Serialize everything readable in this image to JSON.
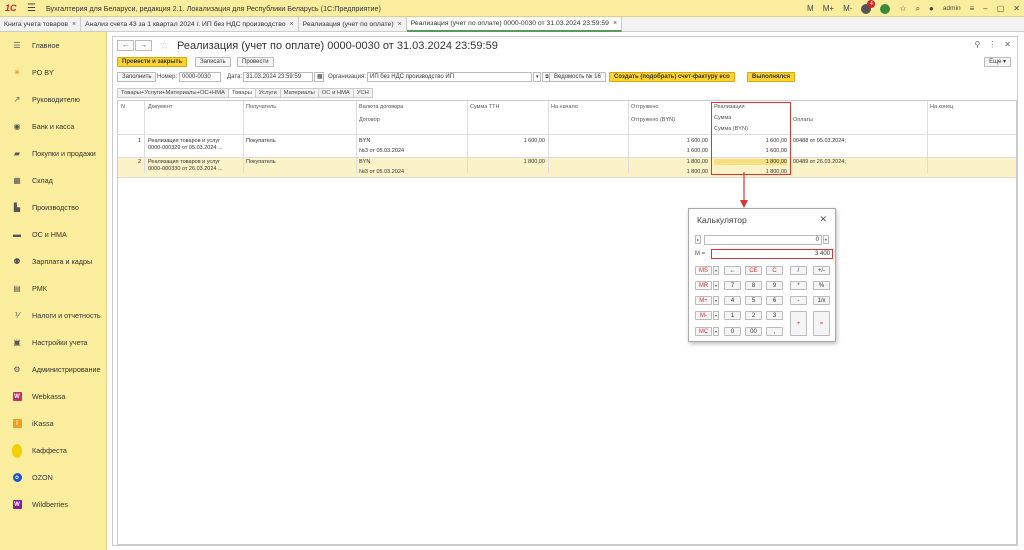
{
  "app": {
    "title": "Бухгалтерия для Беларуси, редакция 2.1. Локализация для Республики Беларусь   (1С:Предприятие)",
    "logo": "1С",
    "right_controls": [
      "M",
      "M+",
      "M-"
    ],
    "notification_count": "4",
    "user": "admin"
  },
  "tabs": [
    {
      "label": "Книга учета товаров"
    },
    {
      "label": "Анализ счета 43 за 1 квартал 2024 г. ИП без НДС производство"
    },
    {
      "label": "Реализация (учет по оплате)"
    },
    {
      "label": "Реализация (учет по оплате) 0000-0030 от 31.03.2024 23:59:59"
    }
  ],
  "sidebar": {
    "items": [
      {
        "label": "Главное",
        "icon": "menu-icon"
      },
      {
        "label": "РО BY",
        "icon": "sun-icon"
      },
      {
        "label": "Руководителю",
        "icon": "trend-icon"
      },
      {
        "label": "Банк и касса",
        "icon": "bank-icon"
      },
      {
        "label": "Покупки и продажи",
        "icon": "cart-icon"
      },
      {
        "label": "Склад",
        "icon": "warehouse-icon"
      },
      {
        "label": "Производство",
        "icon": "factory-icon"
      },
      {
        "label": "ОС и НМА",
        "icon": "car-icon"
      },
      {
        "label": "Зарплата и кадры",
        "icon": "people-icon"
      },
      {
        "label": "РМК",
        "icon": "register-icon"
      },
      {
        "label": "Налоги и отчетность",
        "icon": "tax-icon"
      },
      {
        "label": "Настройки учета",
        "icon": "settings-icon"
      },
      {
        "label": "Администрирование",
        "icon": "gear-icon"
      },
      {
        "label": "Webkassa",
        "icon": "webkassa-icon"
      },
      {
        "label": "iKassa",
        "icon": "ikassa-icon"
      },
      {
        "label": "Каффеста",
        "icon": "kaffesta-icon"
      },
      {
        "label": "OZON",
        "icon": "ozon-icon"
      },
      {
        "label": "Wildberries",
        "icon": "wildberries-icon"
      }
    ]
  },
  "document": {
    "title": "Реализация (учет по оплате) 0000-0030 от 31.03.2024 23:59:59",
    "buttons": {
      "post_close": "Провести и закрыть",
      "save": "Записать",
      "post": "Провести",
      "fill": "Заполнить",
      "invoice": "Создать (подобрать) счет-фактуру eco",
      "executed": "Выполнялся",
      "more": "Еще"
    },
    "fields": {
      "number_label": "Номер:",
      "number": "0000-0030",
      "date_label": "Дата:",
      "date": "31.03.2024 23:59:59",
      "org_label": "Организация:",
      "org": "ИП без НДС производство ИП",
      "statement": "Ведомость № 16"
    },
    "subtabs": [
      "Товары+Услуги+Материалы+ОС+НМА",
      "Товары",
      "Услуги",
      "Материалы",
      "ОС и НМА",
      "УСН"
    ]
  },
  "table": {
    "headers": {
      "n": "N",
      "doc": "Документ",
      "recipient": "Получатель",
      "currency": "Валюта договора",
      "contract": "Договор",
      "sum_ttn": "Сумма ТТН",
      "start": "На начало",
      "shipped": "Отгружено",
      "shipped_byn": "Отгружено (BYN)",
      "realization": "Реализация",
      "sum": "Сумма",
      "sum_byn": "Сумма (BYN)",
      "payments": "Оплаты",
      "end": "На конец"
    },
    "rows": [
      {
        "n": "1",
        "doc_line1": "Реализация товаров и услуг",
        "doc_line2": "0000-000329 от 05.03.2024 ...",
        "recipient": "Покупатель",
        "currency": "BYN",
        "contract": "№3  от 05.03.2024",
        "sum_ttn": "1 600,00",
        "shipped": "1 600,00",
        "shipped_byn": "1 600,00",
        "sum": "1 600,00",
        "sum_byn": "1 600,00",
        "payment": "00488 от 05.03.2024;"
      },
      {
        "n": "2",
        "doc_line1": "Реализация товаров и услуг",
        "doc_line2": "0000-000330 от 26.03.2024 ...",
        "recipient": "Покупатель",
        "currency": "BYN",
        "contract": "№3  от 05.03.2024",
        "sum_ttn": "1 800,00",
        "shipped": "1 800,00",
        "shipped_byn": "1 800,00",
        "sum": "1 800,00",
        "sum_byn": "1 800,00",
        "payment": "00489 от 26.03.2024;"
      }
    ]
  },
  "calculator": {
    "title": "Калькулятор",
    "display": "0",
    "memory_label": "M =",
    "memory_value": "3 400",
    "rows": [
      [
        {
          "t": "MS",
          "red": true,
          "dd": true
        },
        {
          "t": "←"
        },
        {
          "t": "CE",
          "red": true
        },
        {
          "t": "C",
          "red": true
        },
        {
          "t": "/"
        },
        {
          "t": "+/-"
        }
      ],
      [
        {
          "t": "MR",
          "red": true,
          "dd": true
        },
        {
          "t": "7"
        },
        {
          "t": "8"
        },
        {
          "t": "9"
        },
        {
          "t": "*"
        },
        {
          "t": "%"
        }
      ],
      [
        {
          "t": "M+",
          "red": true,
          "dd": true
        },
        {
          "t": "4"
        },
        {
          "t": "5"
        },
        {
          "t": "6"
        },
        {
          "t": "-"
        },
        {
          "t": "1/x"
        }
      ],
      [
        {
          "t": "M-",
          "red": true,
          "dd": true
        },
        {
          "t": "1"
        },
        {
          "t": "2"
        },
        {
          "t": "3"
        }
      ],
      [
        {
          "t": "MC",
          "red": true,
          "dd": true
        },
        {
          "t": "0"
        },
        {
          "t": "00"
        },
        {
          "t": ","
        }
      ]
    ],
    "plus": "+",
    "equals": "="
  },
  "colors": {
    "sidebar_bg": "#fbed9e",
    "accent_button": "#fbd432",
    "highlight_row": "#fcf2c8",
    "annotation_red": "#dd3333"
  }
}
